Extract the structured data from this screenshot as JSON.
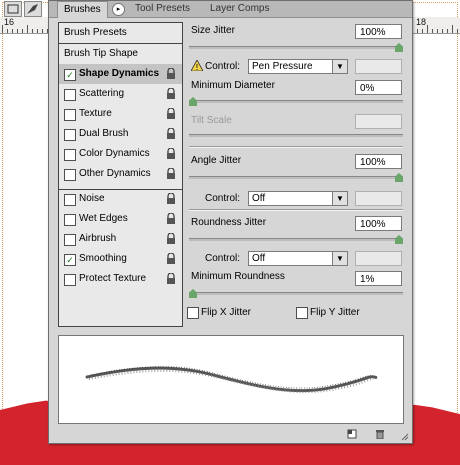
{
  "panel": {
    "tabs": [
      "Brushes",
      "Tool Presets",
      "Layer Comps"
    ],
    "active_tab": "Brushes",
    "tab_menu_glyph": "▸"
  },
  "ruler": {
    "numbers": [
      "16",
      "18"
    ]
  },
  "left": {
    "brush_presets": "Brush Presets",
    "brush_tip_shape": "Brush Tip Shape",
    "items": [
      {
        "label": "Shape Dynamics",
        "checked": true,
        "selected": true
      },
      {
        "label": "Scattering",
        "checked": false
      },
      {
        "label": "Texture",
        "checked": false
      },
      {
        "label": "Dual Brush",
        "checked": false
      },
      {
        "label": "Color Dynamics",
        "checked": false
      },
      {
        "label": "Other Dynamics",
        "checked": false
      },
      {
        "label": "Noise",
        "checked": false
      },
      {
        "label": "Wet Edges",
        "checked": false
      },
      {
        "label": "Airbrush",
        "checked": false
      },
      {
        "label": "Smoothing",
        "checked": true
      },
      {
        "label": "Protect Texture",
        "checked": false
      }
    ]
  },
  "right": {
    "size_jitter": {
      "label": "Size Jitter",
      "value": "100%",
      "level": 1.0
    },
    "control_label": "Control:",
    "size_control": "Pen Pressure",
    "min_diameter": {
      "label": "Minimum Diameter",
      "value": "0%",
      "level": 0.0
    },
    "tilt_scale": {
      "label": "Tilt Scale",
      "value": ""
    },
    "angle_jitter": {
      "label": "Angle Jitter",
      "value": "100%",
      "level": 1.0
    },
    "angle_control": "Off",
    "roundness_jitter": {
      "label": "Roundness Jitter",
      "value": "100%",
      "level": 1.0
    },
    "roundness_control": "Off",
    "min_roundness": {
      "label": "Minimum Roundness",
      "value": "1%",
      "level": 0.0
    },
    "flip_x": {
      "label": "Flip X Jitter",
      "checked": false
    },
    "flip_y": {
      "label": "Flip Y Jitter",
      "checked": false
    }
  },
  "colors": {
    "accent_thumb": "#6aa56a",
    "red_paint": "#d3242d",
    "check_green": "#1a7a1a"
  }
}
